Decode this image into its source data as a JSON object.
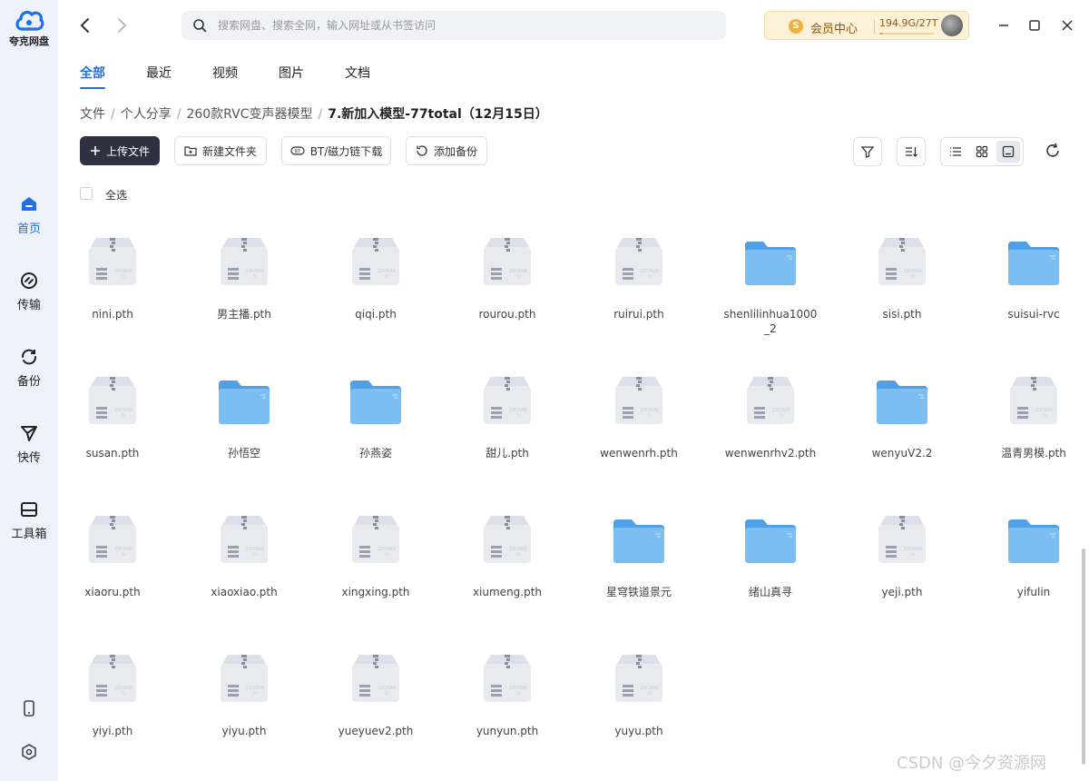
{
  "app": {
    "logo_text": "夸克网盘"
  },
  "sidebar": {
    "items": [
      {
        "label": "首页",
        "icon": "home-icon",
        "active": true
      },
      {
        "label": "传输",
        "icon": "transfer-icon",
        "active": false
      },
      {
        "label": "备份",
        "icon": "backup-icon",
        "active": false
      },
      {
        "label": "快传",
        "icon": "quick-send-icon",
        "active": false
      },
      {
        "label": "工具箱",
        "icon": "toolbox-icon",
        "active": false
      }
    ],
    "bottom_icons": [
      "phone-icon",
      "settings-icon"
    ]
  },
  "search": {
    "placeholder": "搜索网盘、搜索全网，输入网址或从书签访问",
    "value": ""
  },
  "vip": {
    "badge": "S",
    "label": "会员中心",
    "storage": "194.9G/27T",
    "usage_fraction": 0.007
  },
  "tabs": [
    {
      "label": "全部",
      "active": true
    },
    {
      "label": "最近",
      "active": false
    },
    {
      "label": "视频",
      "active": false
    },
    {
      "label": "图片",
      "active": false
    },
    {
      "label": "文档",
      "active": false
    }
  ],
  "breadcrumb": {
    "items": [
      "文件",
      "个人分享",
      "260款RVC变声器模型"
    ],
    "current": "7.新加入模型-77total（12月15日）"
  },
  "toolbar": {
    "upload": "上传文件",
    "new_folder": "新建文件夹",
    "bt_download": "BT/磁力链下载",
    "add_backup": "添加备份"
  },
  "select_all": "全选",
  "files": [
    {
      "name": "nini.pth",
      "type": "archive"
    },
    {
      "name": "男主播.pth",
      "type": "archive"
    },
    {
      "name": "qiqi.pth",
      "type": "archive"
    },
    {
      "name": "rourou.pth",
      "type": "archive"
    },
    {
      "name": "ruirui.pth",
      "type": "archive"
    },
    {
      "name": "shenlilinhua1000_2",
      "type": "folder"
    },
    {
      "name": "sisi.pth",
      "type": "archive"
    },
    {
      "name": "suisui-rvc",
      "type": "folder"
    },
    {
      "name": "susan.pth",
      "type": "archive"
    },
    {
      "name": "孙悟空",
      "type": "folder"
    },
    {
      "name": "孙燕姿",
      "type": "folder"
    },
    {
      "name": "甜儿.pth",
      "type": "archive"
    },
    {
      "name": "wenwenrh.pth",
      "type": "archive"
    },
    {
      "name": "wenwenrhv2.pth",
      "type": "archive"
    },
    {
      "name": "wenyuV2.2",
      "type": "folder"
    },
    {
      "name": "温青男模.pth",
      "type": "archive"
    },
    {
      "name": "xiaoru.pth",
      "type": "archive"
    },
    {
      "name": "xiaoxiao.pth",
      "type": "archive"
    },
    {
      "name": "xingxing.pth",
      "type": "archive"
    },
    {
      "name": "xiumeng.pth",
      "type": "archive"
    },
    {
      "name": "星穹铁道景元",
      "type": "folder"
    },
    {
      "name": "绪山真寻",
      "type": "folder"
    },
    {
      "name": "yeji.pth",
      "type": "archive"
    },
    {
      "name": "yifulin",
      "type": "folder"
    },
    {
      "name": "yiyi.pth",
      "type": "archive"
    },
    {
      "name": "yiyu.pth",
      "type": "archive"
    },
    {
      "name": "yueyuev2.pth",
      "type": "archive"
    },
    {
      "name": "yunyun.pth",
      "type": "archive"
    },
    {
      "name": "yuyu.pth",
      "type": "archive"
    }
  ],
  "watermark": "CSDN @今夕资源网",
  "colors": {
    "accent": "#1e6fe8",
    "sidebar_bg": "#eef2fa",
    "folder": "#6fb6ef",
    "archive": "#e8eaf0"
  }
}
